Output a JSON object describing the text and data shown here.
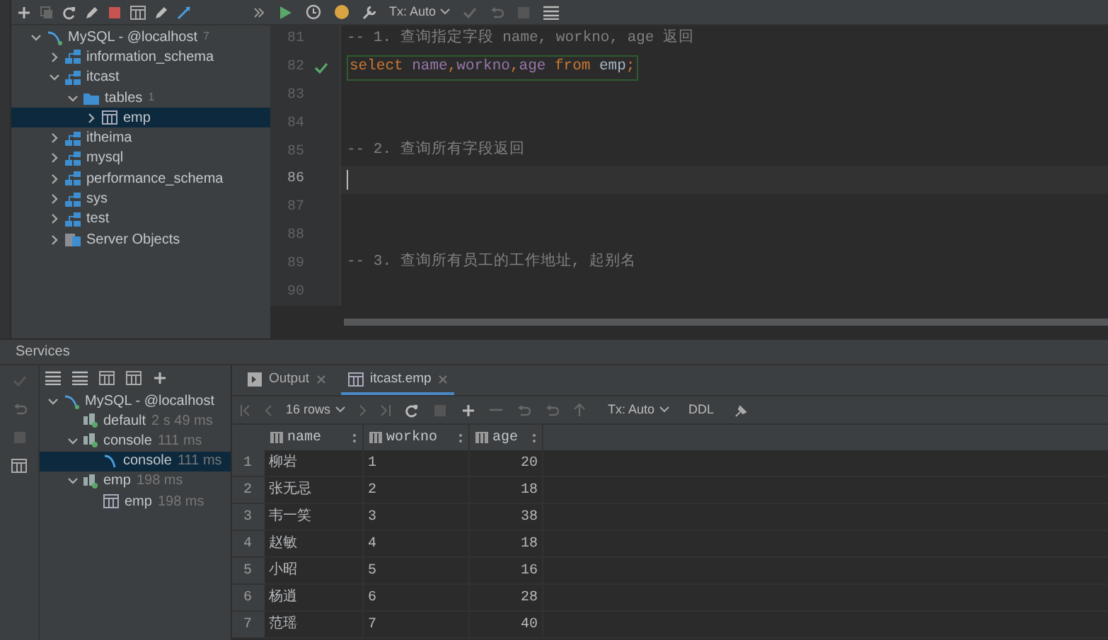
{
  "editor_toolbar": {
    "tx_mode": "Tx: Auto"
  },
  "db_tree": [
    {
      "label": "MySQL - @localhost",
      "count": "7",
      "kind": "datasource",
      "expanded": true,
      "selected": false,
      "children": [
        {
          "label": "information_schema",
          "kind": "schema",
          "expanded": false,
          "selected": false
        },
        {
          "label": "itcast",
          "kind": "schema",
          "expanded": true,
          "selected": false,
          "children": [
            {
              "label": "tables",
              "count": "1",
              "kind": "folder",
              "expanded": true,
              "selected": false,
              "children": [
                {
                  "label": "emp",
                  "kind": "table",
                  "expanded": false,
                  "selected": true
                }
              ]
            }
          ]
        },
        {
          "label": "itheima",
          "kind": "schema",
          "expanded": false,
          "selected": false
        },
        {
          "label": "mysql",
          "kind": "schema",
          "expanded": false,
          "selected": false
        },
        {
          "label": "performance_schema",
          "kind": "schema",
          "expanded": false,
          "selected": false
        },
        {
          "label": "sys",
          "kind": "schema",
          "expanded": false,
          "selected": false
        },
        {
          "label": "test",
          "kind": "schema",
          "expanded": false,
          "selected": false
        },
        {
          "label": "Server Objects",
          "kind": "server",
          "expanded": false,
          "selected": false
        }
      ]
    }
  ],
  "editor": {
    "lines": [
      {
        "number": "81",
        "kind": "comment",
        "text": "-- 1. 查询指定字段 name, workno, age 返回",
        "current": false,
        "ok": false
      },
      {
        "number": "82",
        "kind": "code",
        "tokens": [
          {
            "kind": "keyword",
            "text": "select"
          },
          {
            "kind": "ident",
            "text": "name"
          },
          {
            "kind": "punct",
            "text": ","
          },
          {
            "kind": "ident",
            "text": "workno"
          },
          {
            "kind": "punct",
            "text": ","
          },
          {
            "kind": "ident",
            "text": "age"
          },
          {
            "kind": "keyword",
            "text": "from"
          },
          {
            "kind": "table",
            "text": "emp"
          },
          {
            "kind": "punct",
            "text": ";"
          }
        ],
        "current": false,
        "ok": true
      },
      {
        "number": "83",
        "kind": "blank",
        "current": false,
        "ok": false
      },
      {
        "number": "84",
        "kind": "blank",
        "current": false,
        "ok": false
      },
      {
        "number": "85",
        "kind": "comment",
        "text": "-- 2. 查询所有字段返回",
        "current": false,
        "ok": false
      },
      {
        "number": "86",
        "kind": "blank",
        "current": true,
        "ok": false
      },
      {
        "number": "87",
        "kind": "blank",
        "current": false,
        "ok": false
      },
      {
        "number": "88",
        "kind": "blank",
        "current": false,
        "ok": false
      },
      {
        "number": "89",
        "kind": "comment",
        "text": "-- 3. 查询所有员工的工作地址, 起别名",
        "current": false,
        "ok": false
      },
      {
        "number": "90",
        "kind": "blank",
        "current": false,
        "ok": false
      }
    ]
  },
  "services": {
    "title": "Services",
    "tree": [
      {
        "label": "MySQL - @localhost",
        "kind": "datasource",
        "expanded": true,
        "selected": false,
        "children": [
          {
            "label": "default",
            "time": "2 s 49 ms",
            "kind": "session",
            "expanded": false,
            "selected": false
          },
          {
            "label": "console",
            "time": "111 ms",
            "kind": "session",
            "expanded": true,
            "selected": false,
            "children": [
              {
                "label": "console",
                "time": "111 ms",
                "kind": "console",
                "expanded": false,
                "selected": true
              }
            ]
          },
          {
            "label": "emp",
            "time": "198 ms",
            "kind": "session",
            "expanded": true,
            "selected": false,
            "children": [
              {
                "label": "emp",
                "time": "198 ms",
                "kind": "table",
                "expanded": false,
                "selected": false
              }
            ]
          }
        ]
      }
    ],
    "tabs": [
      {
        "label": "Output",
        "kind": "output",
        "selected": false
      },
      {
        "label": "itcast.emp",
        "kind": "table",
        "selected": true
      }
    ],
    "result_toolbar": {
      "rows": "16 rows",
      "tx_mode": "Tx: Auto",
      "ddl": "DDL"
    },
    "table": {
      "columns": [
        "name",
        "workno",
        "age"
      ],
      "rows": [
        {
          "number": "1",
          "cells": [
            "柳岩",
            "1",
            "20"
          ]
        },
        {
          "number": "2",
          "cells": [
            "张无忌",
            "2",
            "18"
          ]
        },
        {
          "number": "3",
          "cells": [
            "韦一笑",
            "3",
            "38"
          ]
        },
        {
          "number": "4",
          "cells": [
            "赵敏",
            "4",
            "18"
          ]
        },
        {
          "number": "5",
          "cells": [
            "小昭",
            "5",
            "16"
          ]
        },
        {
          "number": "6",
          "cells": [
            "杨逍",
            "6",
            "28"
          ]
        },
        {
          "number": "7",
          "cells": [
            "范瑶",
            "7",
            "40"
          ]
        }
      ]
    }
  }
}
